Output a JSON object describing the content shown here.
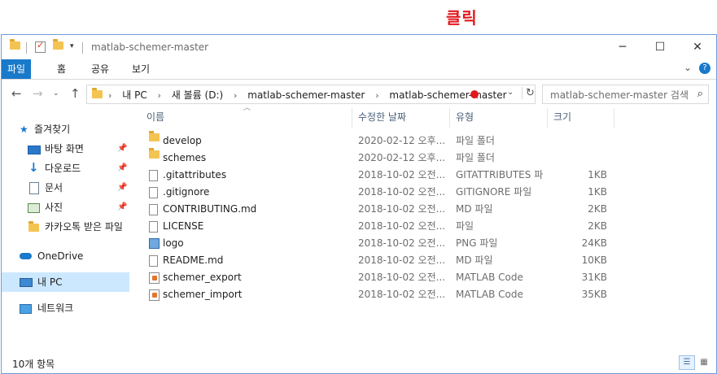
{
  "annotation": {
    "label": "클릭",
    "color": "#e0191e"
  },
  "window": {
    "title": "matlab-schemer-master"
  },
  "ribbon": {
    "tabs": [
      {
        "label": "파일",
        "active": true
      },
      {
        "label": "홈",
        "active": false
      },
      {
        "label": "공유",
        "active": false
      },
      {
        "label": "보기",
        "active": false
      }
    ],
    "help_label": "?"
  },
  "address": {
    "crumbs": [
      "내 PC",
      "새 볼륨 (D:)",
      "matlab-schemer-master",
      "matlab-schemer-master"
    ]
  },
  "search": {
    "placeholder": "matlab-schemer-master 검색"
  },
  "sidebar": {
    "items": [
      {
        "label": "즐겨찾기",
        "icon": "star-icon"
      },
      {
        "label": "바탕 화면",
        "icon": "desktop-icon",
        "pinned": true
      },
      {
        "label": "다운로드",
        "icon": "download-icon",
        "pinned": true
      },
      {
        "label": "문서",
        "icon": "documents-icon",
        "pinned": true
      },
      {
        "label": "사진",
        "icon": "pictures-icon",
        "pinned": true
      },
      {
        "label": "카카오톡 받은 파일",
        "icon": "folder-icon"
      },
      {
        "label": "OneDrive",
        "icon": "cloud-icon"
      },
      {
        "label": "내 PC",
        "icon": "pc-icon",
        "selected": true
      },
      {
        "label": "네트워크",
        "icon": "network-icon"
      }
    ]
  },
  "columns": {
    "name": "이름",
    "date": "수정한 날짜",
    "type": "유형",
    "size": "크기"
  },
  "files": [
    {
      "name": "develop",
      "date": "2020-02-12 오후...",
      "type": "파일 폴더",
      "size": "",
      "kind": "folder"
    },
    {
      "name": "schemes",
      "date": "2020-02-12 오후...",
      "type": "파일 폴더",
      "size": "",
      "kind": "folder"
    },
    {
      "name": ".gitattributes",
      "date": "2018-10-02 오전...",
      "type": "GITATTRIBUTES 파",
      "size": "1KB",
      "kind": "file"
    },
    {
      "name": ".gitignore",
      "date": "2018-10-02 오전...",
      "type": "GITIGNORE 파일",
      "size": "1KB",
      "kind": "file"
    },
    {
      "name": "CONTRIBUTING.md",
      "date": "2018-10-02 오전...",
      "type": "MD 파일",
      "size": "2KB",
      "kind": "file"
    },
    {
      "name": "LICENSE",
      "date": "2018-10-02 오전...",
      "type": "파일",
      "size": "2KB",
      "kind": "file"
    },
    {
      "name": "logo",
      "date": "2018-10-02 오전...",
      "type": "PNG 파일",
      "size": "24KB",
      "kind": "image"
    },
    {
      "name": "README.md",
      "date": "2018-10-02 오전...",
      "type": "MD 파일",
      "size": "10KB",
      "kind": "file"
    },
    {
      "name": "schemer_export",
      "date": "2018-10-02 오전...",
      "type": "MATLAB Code",
      "size": "31KB",
      "kind": "mfile"
    },
    {
      "name": "schemer_import",
      "date": "2018-10-02 오전...",
      "type": "MATLAB Code",
      "size": "35KB",
      "kind": "mfile"
    }
  ],
  "status": {
    "item_count": "10개 항목"
  }
}
